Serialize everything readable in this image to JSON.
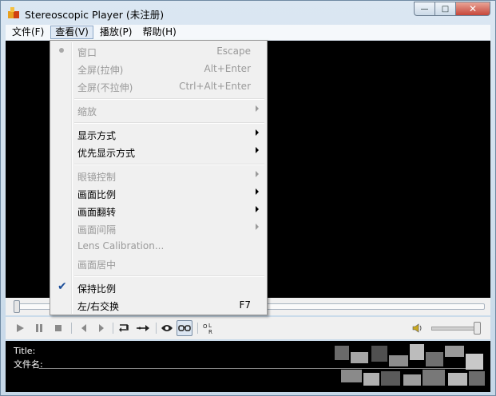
{
  "window": {
    "title": "Stereoscopic Player (未注册)",
    "caption_min": "—",
    "caption_max": "□",
    "caption_close": "✕"
  },
  "menubar": {
    "items": [
      "文件(F)",
      "查看(V)",
      "播放(P)",
      "帮助(H)"
    ],
    "active": "查看(V)"
  },
  "view_menu": {
    "window": {
      "label": "窗口",
      "shortcut": "Escape"
    },
    "full_stretch": {
      "label": "全屏(拉伸)",
      "shortcut": "Alt+Enter"
    },
    "full_nostretch": {
      "label": "全屏(不拉伸)",
      "shortcut": "Ctrl+Alt+Enter"
    },
    "zoom": {
      "label": "缩放"
    },
    "display_mode": {
      "label": "显示方式"
    },
    "preferred_display": {
      "label": "优先显示方式"
    },
    "glasses_control": {
      "label": "眼镜控制"
    },
    "aspect_ratio": {
      "label": "画面比例"
    },
    "flip": {
      "label": "画面翻转"
    },
    "spacing": {
      "label": "画面间隔"
    },
    "lens_calibration": {
      "label": "Lens Calibration..."
    },
    "center": {
      "label": "画面居中"
    },
    "keep_aspect": {
      "label": "保持比例",
      "checked": true
    },
    "swap_lr": {
      "label": "左/右交换",
      "shortcut": "F7"
    }
  },
  "info": {
    "title_label": "Title:",
    "filename_label": "文件名:"
  },
  "icons": {
    "play": "play-icon",
    "pause": "pause-icon",
    "stop": "stop-icon",
    "prev": "prev-icon",
    "next": "next-icon",
    "loop": "loop-icon",
    "step": "frame-step-icon",
    "eye": "eye-icon",
    "glasses": "glasses-icon",
    "lr": "left-right-icon",
    "speaker": "speaker-icon"
  }
}
